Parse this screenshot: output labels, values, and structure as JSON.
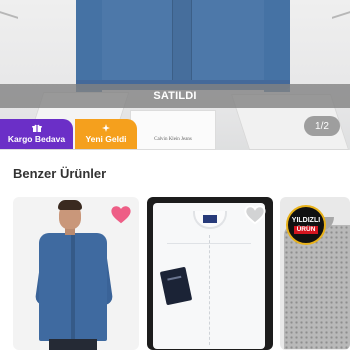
{
  "product": {
    "status_banner": "SATILDI",
    "brand_print": "Calvin Klein Jeans",
    "badges": [
      {
        "label": "Kargo Bedava",
        "icon": "gift-icon",
        "color": "#6b2fc7"
      },
      {
        "label": "Yeni Geldi",
        "icon": "sparkle-icon",
        "color": "#f5a01d"
      }
    ],
    "image_pager": "1/2"
  },
  "similar": {
    "title": "Benzer Ürünler",
    "items": [
      {
        "image": "denim shirt on model",
        "liked": true
      },
      {
        "image": "white packaged dress shirt",
        "liked": false
      },
      {
        "image": "grey patterned shirt",
        "badge_line1": "YILDIZLI",
        "badge_line2": "ÜRÜN"
      }
    ]
  },
  "colors": {
    "kargo_purple": "#6b2fc7",
    "yeni_orange": "#f5a01d",
    "like_pink": "#ee5e86"
  }
}
